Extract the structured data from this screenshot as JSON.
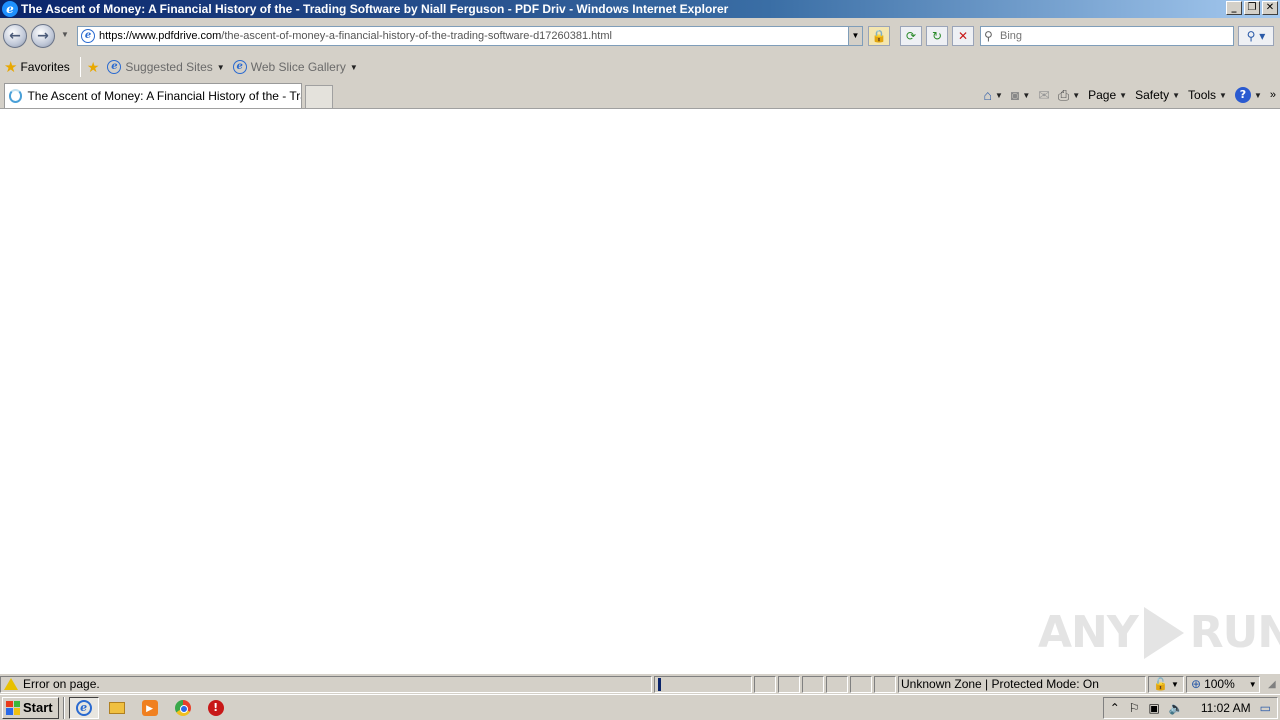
{
  "window": {
    "title": "The Ascent of Money: A Financial History of the - Trading Software by Niall Ferguson - PDF Driv - Windows Internet Explorer",
    "minimize": "_",
    "restore": "❐",
    "close": "✕"
  },
  "address_bar": {
    "scheme": "https://www.",
    "host": "pdfdrive.com",
    "path": "/the-ascent-of-money-a-financial-history-of-the-trading-software-d17260381.html"
  },
  "search": {
    "placeholder": "Bing"
  },
  "favorites_bar": {
    "favorites_label": "Favorites",
    "items": [
      {
        "label": "Suggested Sites"
      },
      {
        "label": "Web Slice Gallery"
      }
    ]
  },
  "tabs": [
    {
      "label": "The Ascent of Money: A Financial History of the - Tra..."
    }
  ],
  "command_bar": {
    "page": "Page",
    "safety": "Safety",
    "tools": "Tools"
  },
  "status_bar": {
    "message": "Error on page.",
    "zone": "Unknown Zone | Protected Mode: On",
    "zoom": "100%"
  },
  "taskbar": {
    "start_label": "Start",
    "clock": "11:02 AM"
  },
  "watermark": {
    "left": "ANY",
    "right": "RUN"
  }
}
